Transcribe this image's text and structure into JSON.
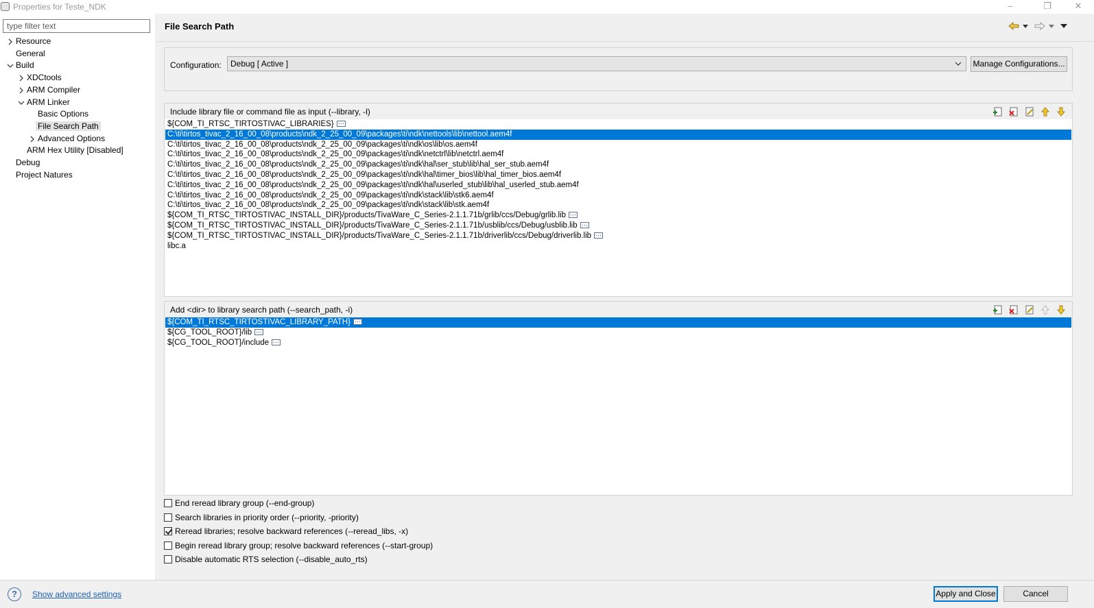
{
  "window": {
    "title": "Properties for Teste_NDK",
    "controls": {
      "minimize": "–",
      "restore": "❐",
      "close": "✕"
    }
  },
  "left": {
    "filter_placeholder": "type filter text",
    "tree": [
      {
        "label": "Resource",
        "expander": "collapsed"
      },
      {
        "label": "General",
        "expander": "none"
      },
      {
        "label": "Build",
        "expander": "expanded"
      },
      {
        "label": "XDCtools",
        "expander": "collapsed"
      },
      {
        "label": "ARM Compiler",
        "expander": "collapsed"
      },
      {
        "label": "ARM Linker",
        "expander": "expanded"
      },
      {
        "label": "Basic Options",
        "expander": "none"
      },
      {
        "label": "File Search Path",
        "expander": "none",
        "selected": true
      },
      {
        "label": "Advanced Options",
        "expander": "collapsed"
      },
      {
        "label": "ARM Hex Utility  [Disabled]",
        "expander": "none"
      },
      {
        "label": "Debug",
        "expander": "none"
      },
      {
        "label": "Project Natures",
        "expander": "none"
      }
    ]
  },
  "main": {
    "title": "File Search Path",
    "configuration": {
      "label": "Configuration:",
      "value": "Debug  [ Active ]",
      "manage_label": "Manage Configurations..."
    },
    "library_group": {
      "title": "Include library file or command file as input (--library, -l)",
      "items": [
        {
          "text": "${COM_TI_RTSC_TIRTOSTIVAC_LIBRARIES}",
          "dots": true
        },
        {
          "text": "C:\\ti\\tirtos_tivac_2_16_00_08\\products\\ndk_2_25_00_09\\packages\\ti\\ndk\\nettools\\lib\\nettool.aem4f",
          "selected": true
        },
        {
          "text": "C:\\ti\\tirtos_tivac_2_16_00_08\\products\\ndk_2_25_00_09\\packages\\ti\\ndk\\os\\lib\\os.aem4f"
        },
        {
          "text": "C:\\ti\\tirtos_tivac_2_16_00_08\\products\\ndk_2_25_00_09\\packages\\ti\\ndk\\netctrl\\lib\\netctrl.aem4f"
        },
        {
          "text": "C:\\ti\\tirtos_tivac_2_16_00_08\\products\\ndk_2_25_00_09\\packages\\ti\\ndk\\hal\\ser_stub\\lib\\hal_ser_stub.aem4f"
        },
        {
          "text": "C:\\ti\\tirtos_tivac_2_16_00_08\\products\\ndk_2_25_00_09\\packages\\ti\\ndk\\hal\\timer_bios\\lib\\hal_timer_bios.aem4f"
        },
        {
          "text": "C:\\ti\\tirtos_tivac_2_16_00_08\\products\\ndk_2_25_00_09\\packages\\ti\\ndk\\hal\\userled_stub\\lib\\hal_userled_stub.aem4f"
        },
        {
          "text": "C:\\ti\\tirtos_tivac_2_16_00_08\\products\\ndk_2_25_00_09\\packages\\ti\\ndk\\stack\\lib\\stk6.aem4f"
        },
        {
          "text": "C:\\ti\\tirtos_tivac_2_16_00_08\\products\\ndk_2_25_00_09\\packages\\ti\\ndk\\stack\\lib\\stk.aem4f"
        },
        {
          "text": "${COM_TI_RTSC_TIRTOSTIVAC_INSTALL_DIR}/products/TivaWare_C_Series-2.1.1.71b/grlib/ccs/Debug/grlib.lib",
          "dots": true
        },
        {
          "text": "${COM_TI_RTSC_TIRTOSTIVAC_INSTALL_DIR}/products/TivaWare_C_Series-2.1.1.71b/usblib/ccs/Debug/usblib.lib",
          "dots": true
        },
        {
          "text": "${COM_TI_RTSC_TIRTOSTIVAC_INSTALL_DIR}/products/TivaWare_C_Series-2.1.1.71b/driverlib/ccs/Debug/driverlib.lib",
          "dots": true
        },
        {
          "text": "libc.a"
        }
      ]
    },
    "path_group": {
      "title": "Add <dir> to library search path (--search_path, -i)",
      "items": [
        {
          "text": "${COM_TI_RTSC_TIRTOSTIVAC_LIBRARY_PATH}",
          "dots": true,
          "selected": true
        },
        {
          "text": "${CG_TOOL_ROOT}/lib",
          "dots": true
        },
        {
          "text": "${CG_TOOL_ROOT}/include",
          "dots": true
        }
      ]
    },
    "options": [
      {
        "label": "End reread library group (--end-group)",
        "checked": false
      },
      {
        "label": "Search libraries in priority order (--priority, -priority)",
        "checked": false
      },
      {
        "label": "Reread libraries; resolve backward references (--reread_libs, -x)",
        "checked": true
      },
      {
        "label": "Begin reread library group; resolve backward references (--start-group)",
        "checked": false
      },
      {
        "label": "Disable automatic RTS selection (--disable_auto_rts)",
        "checked": false
      }
    ]
  },
  "footer": {
    "help_glyph": "?",
    "advanced_link": "Show advanced settings",
    "apply_label": "Apply and Close",
    "cancel_label": "Cancel"
  },
  "colors": {
    "selection": "#0078d7",
    "panel": "#f0f0f0",
    "link": "#1a5fb4"
  }
}
